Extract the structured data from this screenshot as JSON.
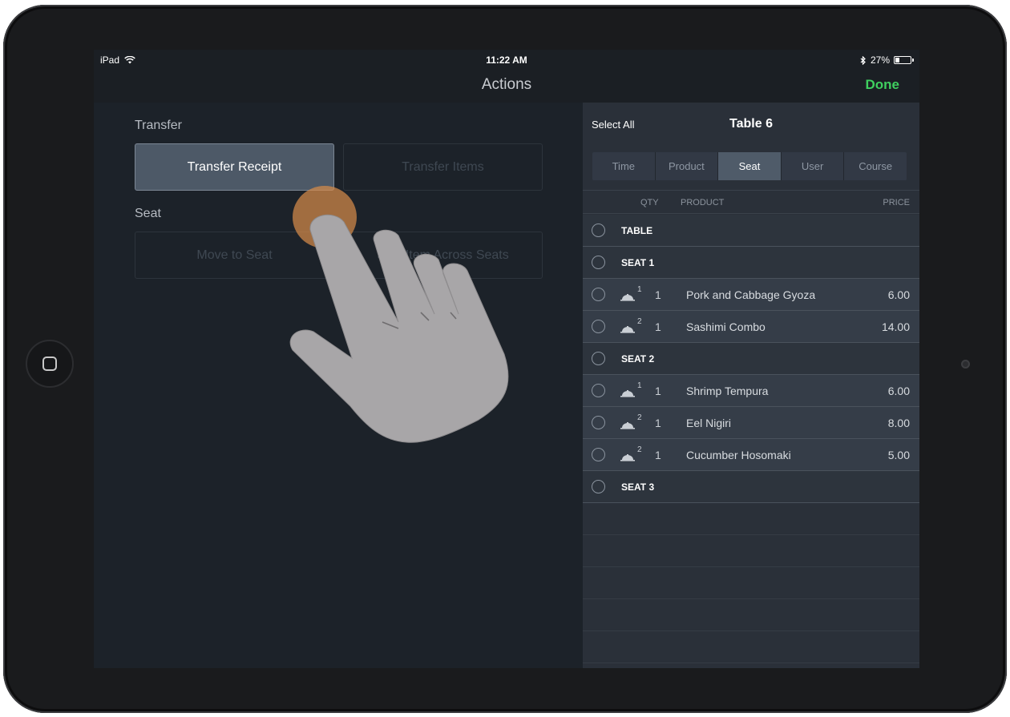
{
  "status_bar": {
    "device": "iPad",
    "time": "11:22 AM",
    "battery": "27%",
    "battery_level": 0.27
  },
  "nav": {
    "title": "Actions",
    "done_label": "Done"
  },
  "actions": {
    "transfer_section": "Transfer",
    "transfer_receipt": "Transfer Receipt",
    "transfer_items": "Transfer Items",
    "seat_section": "Seat",
    "move_to_seat": "Move to Seat",
    "split_item": "Split Item Across Seats"
  },
  "receipt": {
    "select_all": "Select All",
    "table_title": "Table 6",
    "segments": [
      "Time",
      "Product",
      "Seat",
      "User",
      "Course"
    ],
    "active_segment": "Seat",
    "columns": {
      "qty": "QTY",
      "product": "PRODUCT",
      "price": "PRICE"
    },
    "rows": [
      {
        "type": "group",
        "label": "TABLE"
      },
      {
        "type": "group",
        "label": "SEAT 1"
      },
      {
        "type": "item",
        "course": "1",
        "qty": "1",
        "product": "Pork and Cabbage Gyoza",
        "price": "6.00"
      },
      {
        "type": "item",
        "course": "2",
        "qty": "1",
        "product": "Sashimi Combo",
        "price": "14.00"
      },
      {
        "type": "group",
        "label": "SEAT 2"
      },
      {
        "type": "item",
        "course": "1",
        "qty": "1",
        "product": "Shrimp Tempura",
        "price": "6.00"
      },
      {
        "type": "item",
        "course": "2",
        "qty": "1",
        "product": "Eel Nigiri",
        "price": "8.00"
      },
      {
        "type": "item",
        "course": "2",
        "qty": "1",
        "product": "Cucumber Hosomaki",
        "price": "5.00"
      },
      {
        "type": "group",
        "label": "SEAT 3"
      }
    ]
  },
  "colors": {
    "done": "#3fcf5f",
    "active_button": "#4d5967",
    "tap_highlight": "#d68b4a"
  }
}
